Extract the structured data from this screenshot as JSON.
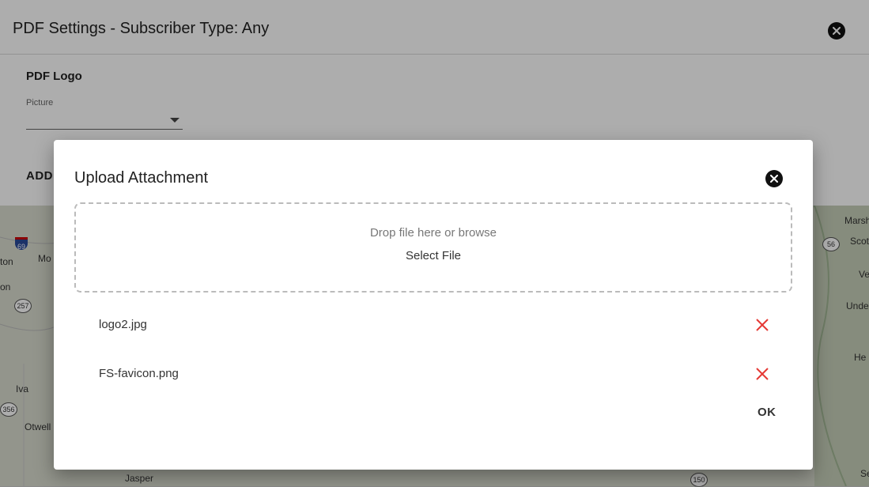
{
  "settings": {
    "title": "PDF Settings - Subscriber Type: Any",
    "section_title": "PDF Logo",
    "picture_label": "Picture",
    "picture_value": "",
    "add_label": "ADD"
  },
  "map": {
    "labels": [
      "Marsh",
      "Scot",
      "ton",
      "Mo",
      "on",
      "Unde",
      "He",
      "Iva",
      "Otwell",
      "Jasper",
      "Ve",
      "Se"
    ],
    "shields": [
      "69",
      "56",
      "257",
      "356",
      "150"
    ]
  },
  "modal": {
    "title": "Upload Attachment",
    "dropzone_text": "Drop file here or browse",
    "select_file_label": "Select File",
    "files": [
      {
        "name": "logo2.jpg"
      },
      {
        "name": "FS-favicon.png"
      }
    ],
    "ok_label": "OK"
  },
  "colors": {
    "remove_icon": "#e53935",
    "close_icon_bg": "#111111"
  }
}
